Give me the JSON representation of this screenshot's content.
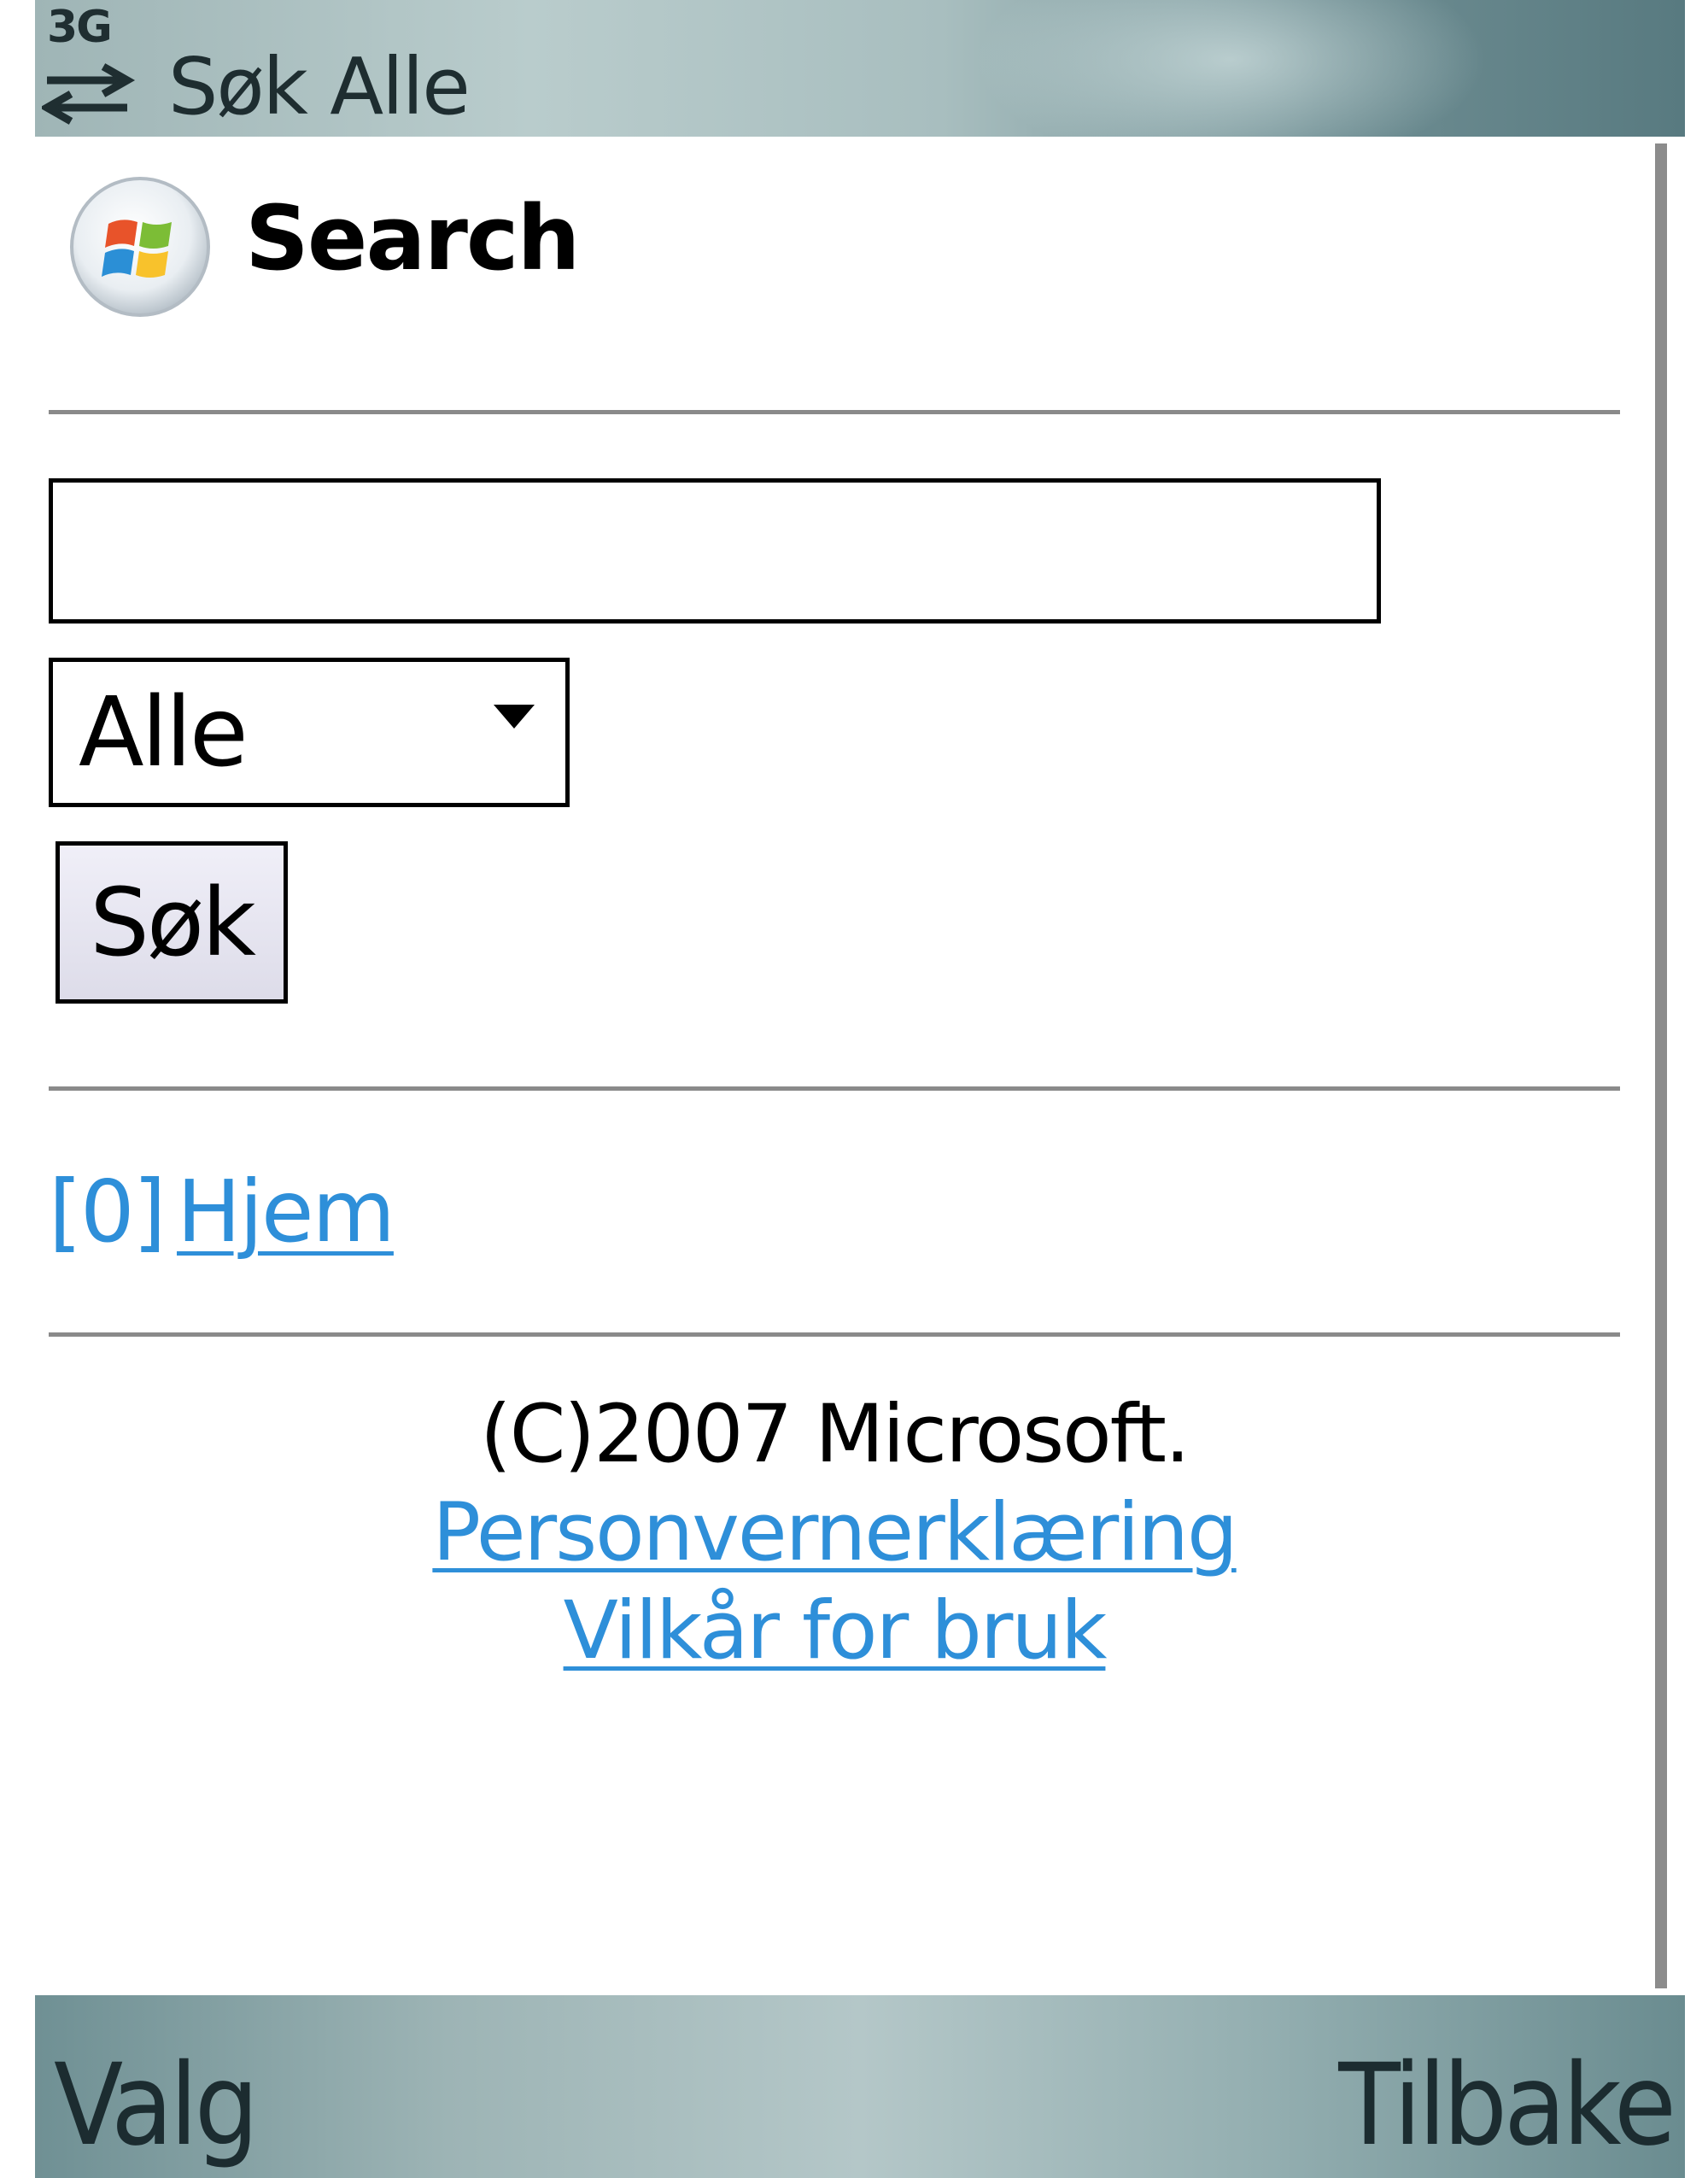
{
  "status_bar": {
    "network_type": "3G",
    "title": "Søk Alle",
    "data_icon": "transfer-arrows-icon"
  },
  "header": {
    "logo_icon": "windows-logo-icon",
    "title": "Search"
  },
  "search": {
    "input_value": "",
    "scope_selected": "Alle",
    "submit_label": "Søk"
  },
  "nav": {
    "home_accesskey": "[0]",
    "home_label": "Hjem"
  },
  "footer": {
    "copyright": "(C)2007 Microsoft.",
    "privacy_label": "Personvernerklæring",
    "terms_label": "Vilkår for bruk"
  },
  "softkeys": {
    "left": "Valg",
    "right": "Tilbake"
  },
  "colors": {
    "link": "#2e8fd9",
    "title_bar": "#8fa9ab",
    "divider": "#8a8a8a"
  }
}
